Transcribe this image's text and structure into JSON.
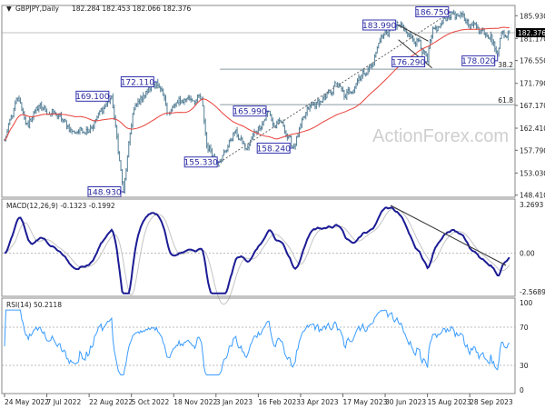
{
  "header": {
    "symbol": "GBPJPY,Daily",
    "ohlc": "182.284 182.453 182.066 182.376"
  },
  "watermark": "ActionForex.com",
  "colors": {
    "bars": "#557f96",
    "ma": "#e8403a",
    "macd": "#1c1c95",
    "signal": "#c4c4c4",
    "rsi": "#3a9cff",
    "label": "#3434b0"
  },
  "chart_data": [
    {
      "type": "ohlc",
      "title": "GBPJPY,Daily",
      "current_price": "182.376",
      "ylim": [
        148.41,
        185.93
      ],
      "y_ticks": [
        "185.930",
        "181.170",
        "176.550",
        "171.790",
        "167.170",
        "162.410",
        "157.790",
        "153.030",
        "148.410"
      ],
      "x_ticks": [
        {
          "date": "2022-05-24",
          "label": "24 May 2022"
        },
        {
          "date": "2022-07-07",
          "label": "7 Jul 2022"
        },
        {
          "date": "2022-08-22",
          "label": "22 Aug 2022"
        },
        {
          "date": "2022-10-05",
          "label": "5 Oct 2022"
        },
        {
          "date": "2022-11-18",
          "label": "18 Nov 2022"
        },
        {
          "date": "2023-01-03",
          "label": "3 Jan 2023"
        },
        {
          "date": "2023-02-16",
          "label": "16 Feb 2023"
        },
        {
          "date": "2023-04-03",
          "label": "3 Apr 2023"
        },
        {
          "date": "2023-05-17",
          "label": "17 May 2023"
        },
        {
          "date": "2023-06-30",
          "label": "30 Jun 2023"
        },
        {
          "date": "2023-08-15",
          "label": "15 Aug 2023"
        },
        {
          "date": "2023-09-28",
          "label": "28 Sep 2023"
        }
      ],
      "price_path": [
        [
          "2022-05-24",
          159.8
        ],
        [
          "2022-06-07",
          168.7
        ],
        [
          "2022-06-17",
          162.6
        ],
        [
          "2022-06-27",
          166.8
        ],
        [
          "2022-07-15",
          165.5
        ],
        [
          "2022-08-04",
          161.7
        ],
        [
          "2022-08-23",
          162.6
        ],
        [
          "2022-09-14",
          169.1
        ],
        [
          "2022-09-27",
          148.93
        ],
        [
          "2022-10-06",
          165.5
        ],
        [
          "2022-10-18",
          169.3
        ],
        [
          "2022-11-01",
          172.11
        ],
        [
          "2022-11-13",
          165.5
        ],
        [
          "2022-11-23",
          167.7
        ],
        [
          "2022-12-02",
          168.7
        ],
        [
          "2022-12-19",
          168.7
        ],
        [
          "2022-12-23",
          158.8
        ],
        [
          "2023-01-06",
          155.33
        ],
        [
          "2023-01-22",
          161.7
        ],
        [
          "2023-02-03",
          157.9
        ],
        [
          "2023-02-14",
          161.7
        ],
        [
          "2023-02-28",
          165.99
        ],
        [
          "2023-03-04",
          162.6
        ],
        [
          "2023-03-14",
          163.6
        ],
        [
          "2023-03-24",
          158.24
        ],
        [
          "2023-04-11",
          166.4
        ],
        [
          "2023-04-28",
          168.7
        ],
        [
          "2023-05-10",
          171.7
        ],
        [
          "2023-05-19",
          168.7
        ],
        [
          "2023-06-02",
          173.1
        ],
        [
          "2023-06-16",
          175.5
        ],
        [
          "2023-06-27",
          181.6
        ],
        [
          "2023-07-14",
          183.99
        ],
        [
          "2023-07-26",
          181.6
        ],
        [
          "2023-08-07",
          180.7
        ],
        [
          "2023-08-15",
          176.29
        ],
        [
          "2023-08-18",
          181.6
        ],
        [
          "2023-08-29",
          183.9
        ],
        [
          "2023-09-05",
          185.8
        ],
        [
          "2023-09-08",
          186.75
        ],
        [
          "2023-09-22",
          185.0
        ],
        [
          "2023-10-06",
          183.5
        ],
        [
          "2023-10-20",
          182.0
        ],
        [
          "2023-10-27",
          178.02
        ],
        [
          "2023-11-01",
          182.6
        ],
        [
          "2023-11-09",
          182.376
        ]
      ],
      "pivot_labels": [
        {
          "date": "2022-09-14",
          "price": 169.1,
          "text": "169.100"
        },
        {
          "date": "2022-09-27",
          "price": 148.93,
          "text": "148.930"
        },
        {
          "date": "2022-11-01",
          "price": 172.11,
          "text": "172.110"
        },
        {
          "date": "2023-01-06",
          "price": 155.33,
          "text": "155.330"
        },
        {
          "date": "2023-02-28",
          "price": 165.99,
          "text": "165.990"
        },
        {
          "date": "2023-03-24",
          "price": 158.24,
          "text": "158.240"
        },
        {
          "date": "2023-07-14",
          "price": 183.99,
          "text": "183.990"
        },
        {
          "date": "2023-08-15",
          "price": 176.29,
          "text": "176.290"
        },
        {
          "date": "2023-09-08",
          "price": 186.75,
          "text": "186.750"
        },
        {
          "date": "2023-10-27",
          "price": 178.02,
          "text": "178.020"
        }
      ],
      "fib_levels": [
        {
          "label": "38.2",
          "price": 174.75
        },
        {
          "label": "61.8",
          "price": 167.33
        }
      ],
      "moving_average": "red line"
    },
    {
      "type": "line",
      "title": "MACD(12,26,9) -0.1323 -0.1992",
      "ylim": [
        -2.5689,
        3.2693
      ],
      "y_ticks": [
        "3.2693",
        "0.00",
        "-2.5689"
      ],
      "series": [
        {
          "name": "MACD(12,26,9)",
          "last": -0.1323
        },
        {
          "name": "signal",
          "last": -0.1992
        }
      ]
    },
    {
      "type": "line",
      "title": "RSI(14) 50.2118",
      "ylim": [
        0,
        100
      ],
      "y_ticks": [
        "100",
        "70",
        "30",
        "0"
      ],
      "levels": [
        70,
        30
      ],
      "series": [
        {
          "name": "RSI(14)",
          "last": 50.2118
        }
      ]
    }
  ]
}
